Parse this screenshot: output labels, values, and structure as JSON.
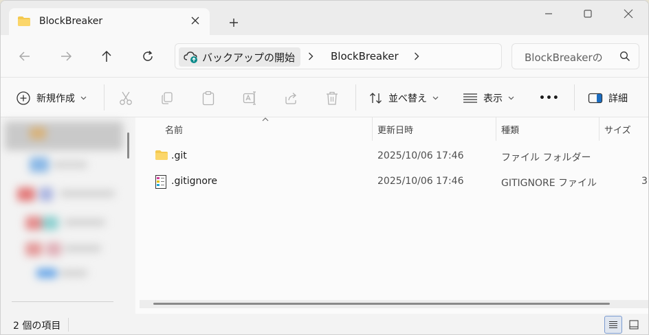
{
  "window": {
    "tab_title": "BlockBreaker",
    "new_tab_symbol": "+"
  },
  "address": {
    "root_label": "バックアップの開始",
    "current_folder": "BlockBreaker",
    "search_placeholder": "BlockBreakerの"
  },
  "toolbar": {
    "new_label": "新規作成",
    "sort_label": "並べ替え",
    "view_label": "表示",
    "more_label": "•••",
    "details_label": "詳細"
  },
  "columns": {
    "name": "名前",
    "modified": "更新日時",
    "type": "種類",
    "size": "サイズ"
  },
  "files": [
    {
      "name": ".git",
      "modified": "2025/10/06 17:46",
      "type": "ファイル フォルダー",
      "size": "",
      "icon": "folder-icon"
    },
    {
      "name": ".gitignore",
      "modified": "2025/10/06 17:46",
      "type": "GITIGNORE ファイル",
      "size": "3",
      "icon": "file-icon"
    }
  ],
  "status": {
    "item_count": "2 個の項目"
  },
  "colors": {
    "folder": "#f4c94f",
    "accent": "#0067c0",
    "window_bg": "#f3f3f3"
  }
}
